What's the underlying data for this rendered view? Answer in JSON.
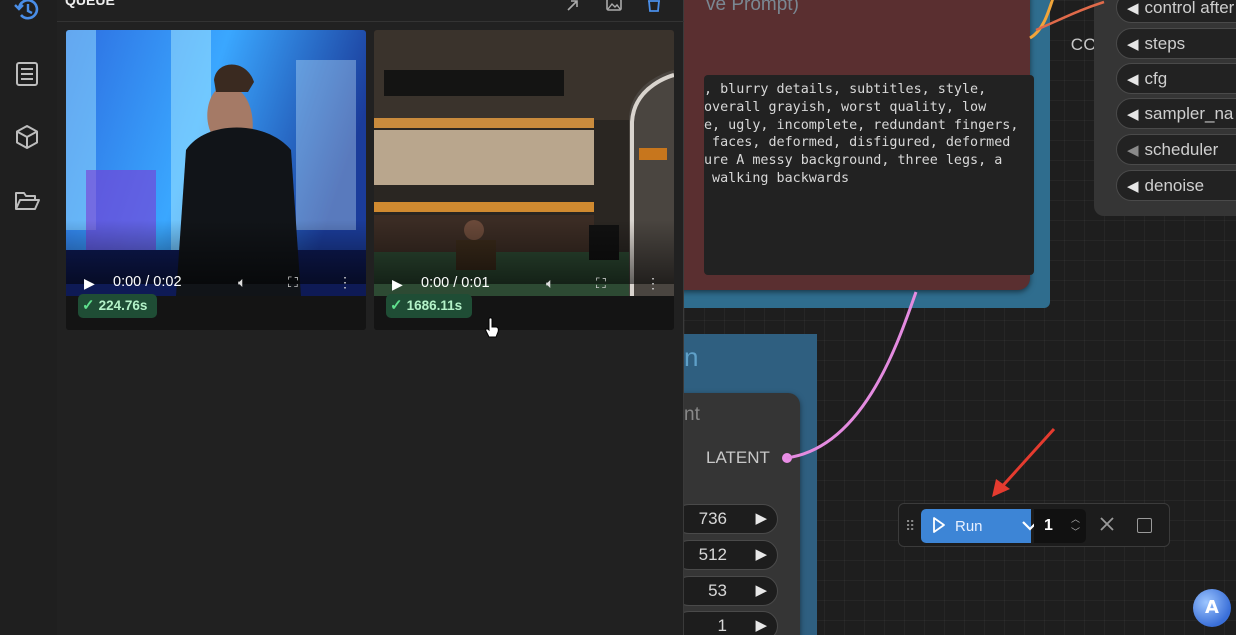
{
  "queue": {
    "title": "QUEUE",
    "items": [
      {
        "time": "0:00 / 0:02",
        "duration_badge": "224.76s"
      },
      {
        "time": "0:00 / 0:01",
        "duration_badge": "1686.11s"
      }
    ]
  },
  "negative_node": {
    "title": "ve Prompt)",
    "output_label": "CONDITIONING",
    "text": ", blurry details, subtitles, style,\noverall grayish, worst quality, low\ne, ugly, incomplete, redundant fingers,\n faces, deformed, disfigured, deformed\nure A messy background, three legs, a\n walking backwards"
  },
  "ksampler": {
    "widgets": [
      "control after",
      "steps",
      "cfg",
      "sampler_na",
      "scheduler",
      "denoise"
    ]
  },
  "latent_group": {
    "title": "n"
  },
  "latent_node": {
    "title": "nt",
    "output_label": "LATENT",
    "values": [
      "736",
      "512",
      "53",
      "1"
    ]
  },
  "runbar": {
    "run_label": "Run",
    "batch_count": "1"
  },
  "brand": {
    "badge_text": "A"
  },
  "colors": {
    "run_blue": "#3d85d6",
    "conditioning_dot": "#f0a53a",
    "latent_dot": "#e98ee6",
    "badge_green": "#1f4d35",
    "negative_node_bg": "#5a2f30",
    "group_blue": "#2f6d8e"
  }
}
